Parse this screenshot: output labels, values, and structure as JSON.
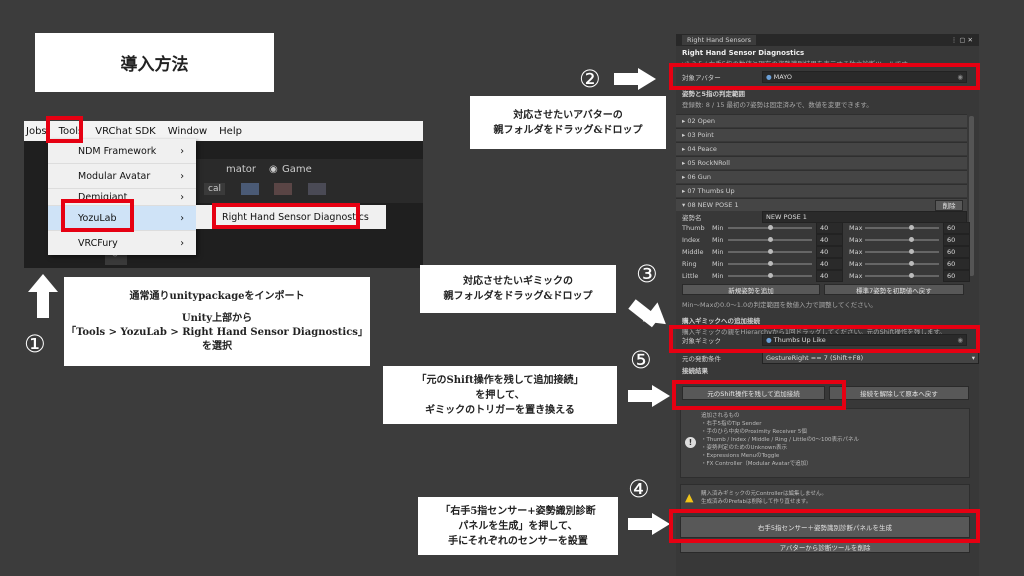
{
  "title": "導入方法",
  "menu": {
    "items": [
      "Jobs",
      "Tools",
      "VRChat SDK",
      "Window",
      "Help"
    ],
    "tools_submenu": [
      {
        "label": "NDM Framework"
      },
      {
        "label": "Modular Avatar"
      },
      {
        "label": "Demigiant"
      },
      {
        "label": "YozuLab"
      },
      {
        "label": "VRCFury"
      }
    ],
    "yozulab_item": "Right Hand Sensor Diagnostics",
    "toolbar_tab_animator": "mator",
    "toolbar_tab_game": "Game",
    "toolbar_field": "cal"
  },
  "step1": {
    "number": "①",
    "text_1": "通常通りunitypackageをインポート",
    "text_2": "Unity上部から",
    "text_3": "「Tools > YozuLab > Right Hand Sensor Diagnostics」",
    "text_4": "を選択"
  },
  "step2": {
    "number": "②",
    "text_1": "対応させたいアバターの",
    "text_2": "親フォルダをドラッグ&ドロップ"
  },
  "step3": {
    "number": "③",
    "text_1": "対応させたいギミックの",
    "text_2": "親フォルダをドラッグ&ドロップ"
  },
  "step4": {
    "number": "④",
    "text_1": "「右手5指センサー+姿勢識別診断",
    "text_2": "パネルを生成」を押して、",
    "text_3": "手にそれぞれのセンサーを設置"
  },
  "step5": {
    "number": "⑤",
    "text_1": "「元のShift操作を残して追加接続」",
    "text_2": "を押して、",
    "text_3": "ギミックのトリガーを置き換える"
  },
  "panel": {
    "tab": "Right Hand Sensors",
    "header": "Right Hand Sensor Diagnostics",
    "version": "v1.3.5 / 右手5指の数値と現在の姿勢識別結果を表示する独立診断ツールです。",
    "avatar_label": "対象アバター",
    "avatar_value": "MAYO",
    "section_pose": "姿勢と5指の判定範囲",
    "pose_note": "登録数: 8 / 15  最初の7姿勢は固定済みで、数値を変更できます。",
    "poses": [
      "▸ 02  Open",
      "▸ 03  Point",
      "▸ 04  Peace",
      "▸ 05  RockNRoll",
      "▸ 06  Gun",
      "▸ 07  Thumbs Up"
    ],
    "pose8": "▾ 08  NEW POSE 1",
    "delete": "削除",
    "pose_name_label": "姿勢名",
    "pose_name_value": "NEW POSE 1",
    "min_label": "Min",
    "max_label": "Max",
    "fingers": [
      {
        "name": "Thumb",
        "min": "40",
        "max": "60"
      },
      {
        "name": "Index",
        "min": "40",
        "max": "60"
      },
      {
        "name": "Middle",
        "min": "40",
        "max": "60"
      },
      {
        "name": "Ring",
        "min": "40",
        "max": "60"
      },
      {
        "name": "Little",
        "min": "40",
        "max": "60"
      }
    ],
    "add_pose": "新規姿勢を追加",
    "reset_pose": "標準7姿勢を初期値へ戻す",
    "minmax_note": "Min〜Maxの0.0〜1.0の判定範囲を数値入力で調整してください。",
    "section_gimmick": "購入ギミックへの追加接続",
    "gimmick_note": "購入ギミックの親をHierarchyから1回ドラッグしてください。元のShift操作を残します。",
    "gimmick_label": "対象ギミック",
    "gimmick_value": "Thumbs Up Like",
    "trigger_label": "元の発動条件",
    "trigger_value": "GestureRight == 7 (Shift+F8)",
    "section_result": "接続結果",
    "connect_btn": "元のShift操作を残して追加接続",
    "disconnect_btn": "接続を解除して原本へ戻す",
    "info_1": "追加されるもの",
    "info_2": "・右手5指のTip Sender",
    "info_3": "・手のひら中央のProximity Receiver 5個",
    "info_4": "・Thumb / Index / Middle / Ring / Littleの0〜100表示パネル",
    "info_5": "・姿勢判定のためのUnknown表示",
    "info_6": "・Expressions MenuのToggle",
    "info_7": "・FX Controller（Modular Avatarで追加）",
    "warn_1": "購入済みギミックの元Controllerは編集しません。",
    "warn_2": "生成済みのPrefabは削除して作り直せます。",
    "generate_btn": "右手5指センサー＋姿勢識別診断パネルを生成",
    "remove_btn": "アバターから診断ツールを削除"
  }
}
